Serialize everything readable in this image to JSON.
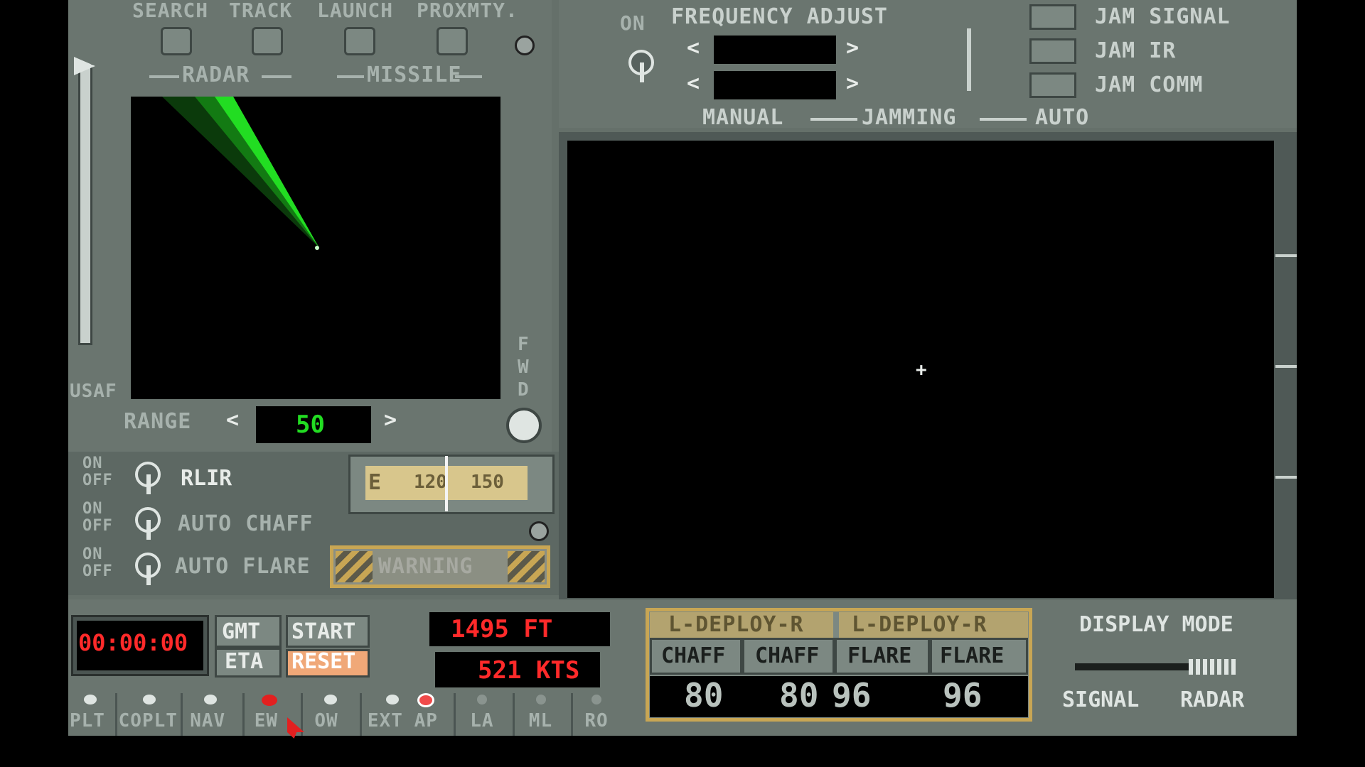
{
  "radar": {
    "modes": [
      "SEARCH",
      "TRACK",
      "LAUNCH",
      "PROXMTY."
    ],
    "group_radar": "RADAR",
    "group_missile": "MISSILE",
    "side_label": "USAF",
    "fwd_letters": [
      "F",
      "W",
      "D"
    ],
    "range_label": "RANGE",
    "range_value": "50",
    "left_arrow": "<",
    "right_arrow": ">"
  },
  "jamming": {
    "on_label": "ON",
    "header": "FREQUENCY ADJUST",
    "arrow_left": "<",
    "arrow_right": ">",
    "rows": [
      {
        "name": "JAM SIGNAL"
      },
      {
        "name": "JAM IR"
      },
      {
        "name": "JAM COMM"
      }
    ],
    "manual": "MANUAL",
    "jamming": "JAMMING",
    "auto": "AUTO"
  },
  "controls": {
    "toggles": [
      {
        "on": "ON",
        "off": "OFF",
        "label": "RLIR"
      },
      {
        "on": "ON",
        "off": "OFF",
        "label": "AUTO  CHAFF"
      },
      {
        "on": "ON",
        "off": "OFF",
        "label": "AUTO  FLARE"
      }
    ],
    "compass": {
      "e": "E",
      "t1": "120",
      "t2": "150"
    },
    "warning": "WARNING"
  },
  "clock": {
    "time": "00:00:00",
    "gmt": "GMT",
    "eta": "ETA",
    "start": "START",
    "reset": "RESET"
  },
  "flight": {
    "altitude": "1495  FT",
    "speed": "521 KTS"
  },
  "countermeasures": {
    "deploy_left": "L-DEPLOY-R",
    "deploy_right": "L-DEPLOY-R",
    "cols": [
      {
        "label": "CHAFF",
        "value": "80"
      },
      {
        "label": "CHAFF",
        "value": "80"
      },
      {
        "label": "FLARE",
        "value": "96"
      },
      {
        "label": "FLARE",
        "value": "96"
      }
    ]
  },
  "display_mode": {
    "title": "DISPLAY  MODE",
    "left": "SIGNAL",
    "right": "RADAR"
  },
  "stations": [
    {
      "label": "PLT",
      "lamp": "grey"
    },
    {
      "label": "COPLT",
      "lamp": "grey"
    },
    {
      "label": "NAV",
      "lamp": "grey"
    },
    {
      "label": "EW",
      "lamp": "red"
    },
    {
      "label": "OW",
      "lamp": "grey"
    },
    {
      "label": "EXT",
      "lamp": "grey"
    },
    {
      "label": "AP",
      "lamp": "red"
    },
    {
      "label": "LA",
      "lamp": "grey"
    },
    {
      "label": "ML",
      "lamp": "grey"
    },
    {
      "label": "RO",
      "lamp": "grey"
    }
  ],
  "colors": {
    "panel": "#65706a",
    "screen": "#000000",
    "radar_beam": "#22dd22",
    "led_red": "#ff2a2a",
    "amber": "#c8a654"
  }
}
